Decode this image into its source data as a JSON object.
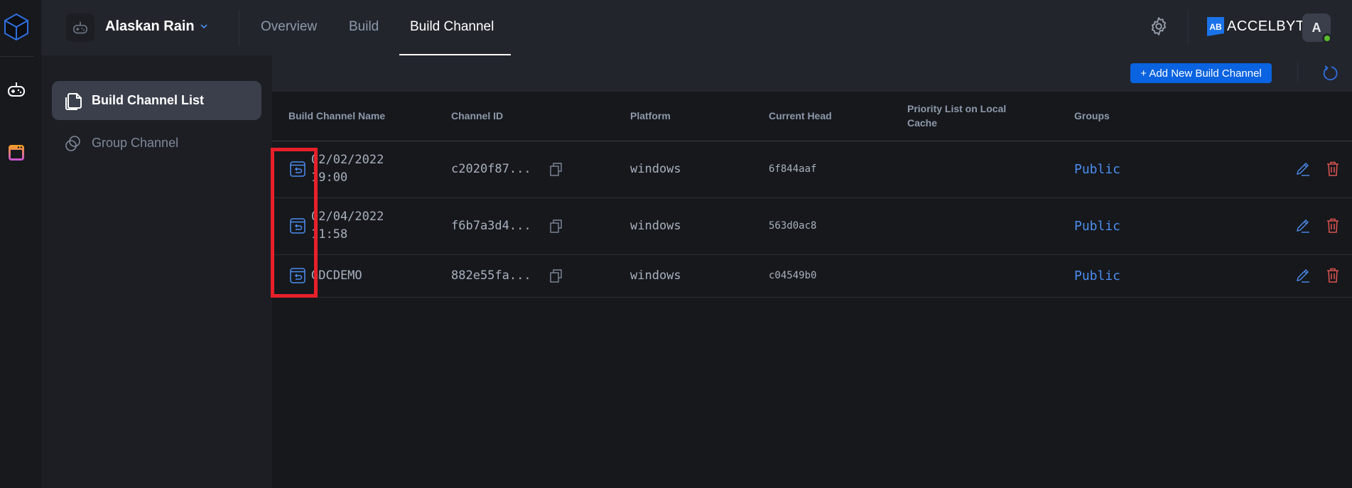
{
  "rail": {
    "items": [
      {
        "name": "game-controller",
        "icon": "gamepad-icon"
      },
      {
        "name": "app",
        "icon": "app-window-icon"
      }
    ]
  },
  "topbar": {
    "project_name": "Alaskan Rain",
    "tabs": [
      {
        "label": "Overview",
        "active": false
      },
      {
        "label": "Build",
        "active": false
      },
      {
        "label": "Build Channel",
        "active": true
      }
    ],
    "brand_mark": "AB",
    "brand_text": "ACCELBYTE",
    "avatar_initial": "A",
    "status_color": "#5bbd2b"
  },
  "sidebar": {
    "items": [
      {
        "label": "Build Channel List",
        "active": true
      },
      {
        "label": "Group Channel",
        "active": false
      }
    ]
  },
  "toolbar": {
    "add_button_label": "+ Add New Build Channel"
  },
  "table": {
    "columns": [
      "Build Channel Name",
      "Channel ID",
      "Platform",
      "Current Head",
      "Priority List on Local Cache",
      "Groups"
    ],
    "rows": [
      {
        "name_line1": "02/02/2022",
        "name_line2": "19:00",
        "channel_id": "c2020f87...",
        "platform": "windows",
        "current_head": "6f844aaf",
        "priority": "",
        "groups": "Public"
      },
      {
        "name_line1": "02/04/2022",
        "name_line2": "11:58",
        "channel_id": "f6b7a3d4...",
        "platform": "windows",
        "current_head": "563d0ac8",
        "priority": "",
        "groups": "Public"
      },
      {
        "name_line1": "GDCDEMO",
        "name_line2": "",
        "channel_id": "882e55fa...",
        "platform": "windows",
        "current_head": "c04549b0",
        "priority": "",
        "groups": "Public"
      }
    ]
  },
  "colors": {
    "accent": "#0a63e0",
    "link": "#4c8ef0",
    "danger": "#d9534f",
    "highlight": "#e8202a"
  }
}
